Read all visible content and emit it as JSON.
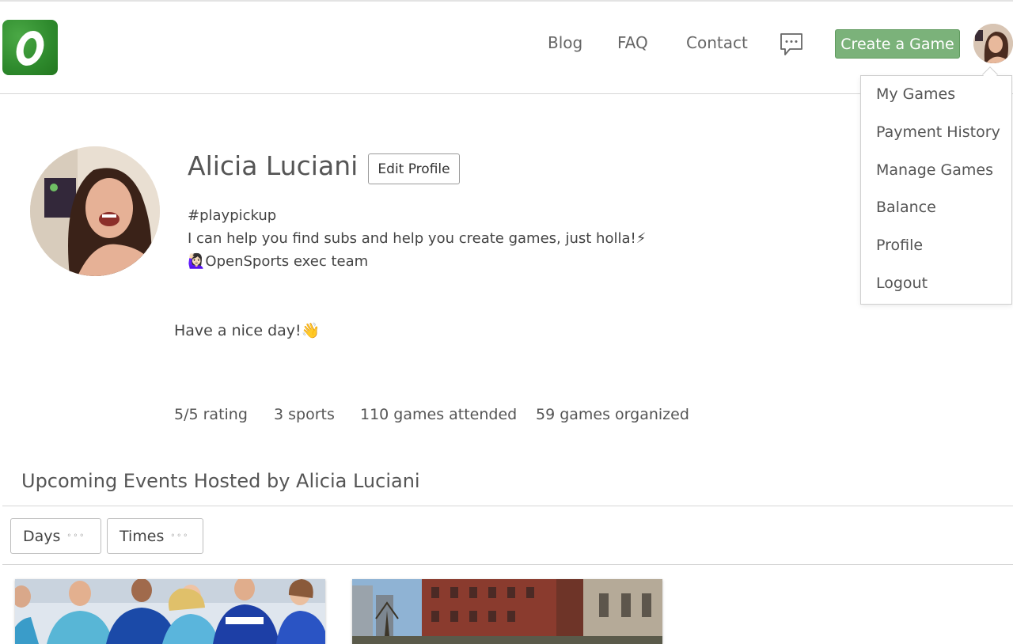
{
  "nav": {
    "links": [
      "Blog",
      "FAQ",
      "Contact"
    ],
    "create_label": "Create a Game",
    "icons": {
      "logo": "opensports-logo",
      "chat": "chat-bubble-icon",
      "avatar": "user-avatar"
    },
    "colors": {
      "brand": "#2e8a2d",
      "create_button": "#7bb27a"
    }
  },
  "dropdown": {
    "items": [
      "My Games",
      "Payment History",
      "Manage Games",
      "Balance",
      "Profile",
      "Logout"
    ]
  },
  "profile": {
    "name": "Alicia Luciani",
    "edit_label": "Edit Profile",
    "bio": [
      "#playpickup",
      "I can help you find subs and help you create games, just holla!⚡",
      "🙋🏻‍♀️OpenSports exec team"
    ],
    "greeting": "Have a nice day!👋",
    "stats": [
      "5/5 rating",
      "3 sports",
      "110 games attended",
      "59 games organized"
    ]
  },
  "events": {
    "title": "Upcoming Events Hosted by Alicia Luciani",
    "filters": [
      "Days",
      "Times"
    ],
    "filter_dots": "◦◦◦"
  }
}
